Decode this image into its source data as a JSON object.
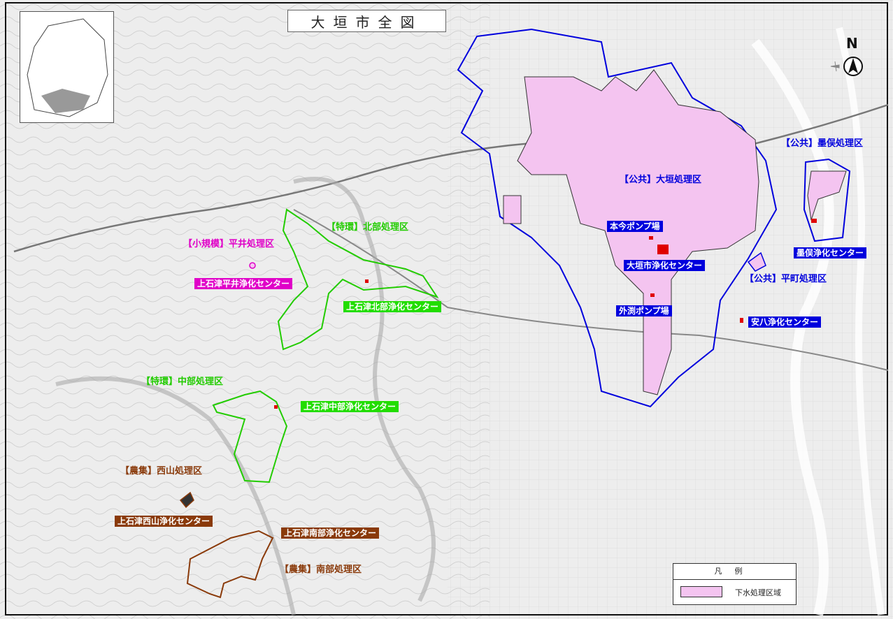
{
  "map_title": "大垣市全図",
  "north_label": "N",
  "labels": {
    "ogaki_district": "【公共】大垣処理区",
    "sunomata_district": "【公共】墨俣処理区",
    "hiramachi_district": "【公共】平町処理区",
    "hokubu_district": "【特環】北部処理区",
    "chubu_district": "【特環】中部処理区",
    "hirai_district": "【小規模】平井処理区",
    "nishiyama_district": "【農集】西山処理区",
    "nanbu_district": "【農集】南部処理区"
  },
  "facilities": {
    "honkon_pump": "本今ポンプ場",
    "ogaki_center": "大垣市浄化センター",
    "gaibuchi_pump": "外渕ポンプ場",
    "sunomata_center": "墨俣浄化センター",
    "anpachi_center": "安八浄化センター",
    "hokubu_center": "上石津北部浄化センター",
    "hirai_center": "上石津平井浄化センター",
    "chubu_center": "上石津中部浄化センター",
    "nishiyama_center": "上石津西山浄化センター",
    "nanbu_center": "上石津南部浄化センター"
  },
  "legend": {
    "title": "凡例",
    "item": "下水処理区域"
  },
  "colors": {
    "public": "#0000dd",
    "tokkan": "#22cc00",
    "small": "#e000c8",
    "nousyuu": "#8a3a0a",
    "area_fill": "#f4c4f0",
    "facility": "#e00000"
  }
}
